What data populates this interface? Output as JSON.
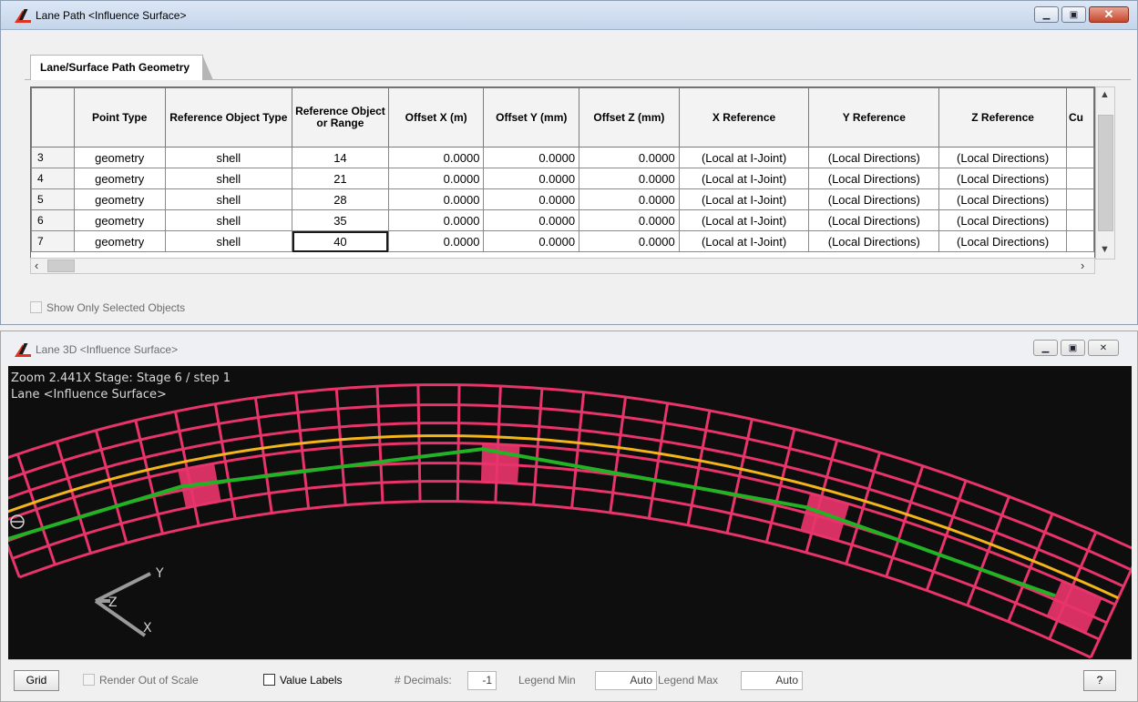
{
  "top_window": {
    "title": "Lane Path <Influence Surface>",
    "tab": "Lane/Surface Path Geometry",
    "columns": [
      {
        "label": "Point Type"
      },
      {
        "label": "Reference Object Type"
      },
      {
        "label": "Reference Object or Range"
      },
      {
        "label": "Offset X (m)"
      },
      {
        "label": "Offset Y (mm)"
      },
      {
        "label": "Offset Z (mm)"
      },
      {
        "label": "X Reference"
      },
      {
        "label": "Y Reference"
      },
      {
        "label": "Z Reference"
      },
      {
        "label": "Cu"
      }
    ],
    "rows": [
      {
        "num": "3",
        "point_type": "geometry",
        "ref_type": "shell",
        "ref_obj": "14",
        "ox": "0.0000",
        "oy": "0.0000",
        "oz": "0.0000",
        "xref": "(Local at I-Joint)",
        "yref": "(Local Directions)",
        "zref": "(Local Directions)"
      },
      {
        "num": "4",
        "point_type": "geometry",
        "ref_type": "shell",
        "ref_obj": "21",
        "ox": "0.0000",
        "oy": "0.0000",
        "oz": "0.0000",
        "xref": "(Local at I-Joint)",
        "yref": "(Local Directions)",
        "zref": "(Local Directions)"
      },
      {
        "num": "5",
        "point_type": "geometry",
        "ref_type": "shell",
        "ref_obj": "28",
        "ox": "0.0000",
        "oy": "0.0000",
        "oz": "0.0000",
        "xref": "(Local at I-Joint)",
        "yref": "(Local Directions)",
        "zref": "(Local Directions)"
      },
      {
        "num": "6",
        "point_type": "geometry",
        "ref_type": "shell",
        "ref_obj": "35",
        "ox": "0.0000",
        "oy": "0.0000",
        "oz": "0.0000",
        "xref": "(Local at I-Joint)",
        "yref": "(Local Directions)",
        "zref": "(Local Directions)"
      },
      {
        "num": "7",
        "point_type": "geometry",
        "ref_type": "shell",
        "ref_obj": "40",
        "ox": "0.0000",
        "oy": "0.0000",
        "oz": "0.0000",
        "xref": "(Local at I-Joint)",
        "yref": "(Local Directions)",
        "zref": "(Local Directions)"
      }
    ],
    "show_only_selected": "Show Only Selected Objects"
  },
  "bottom_window": {
    "title": "Lane 3D <Influence Surface>",
    "zoom_line": "Zoom  2.441X    Stage: Stage 6 / step 1",
    "lane_line": "Lane <Influence Surface>",
    "axis_y": "Y",
    "axis_z": "Z",
    "axis_x": "X",
    "toolbar": {
      "grid_button": "Grid",
      "render_out_of_scale": "Render Out of Scale",
      "value_labels": "Value Labels",
      "decimals_label": "# Decimals:",
      "decimals_value": "-1",
      "legend_min_label": "Legend Min",
      "legend_min_value": "Auto",
      "legend_max_label": "Legend Max",
      "legend_max_value": "Auto",
      "help_button": "?"
    }
  },
  "colors": {
    "mesh": "#e8346a",
    "lane_path": "#f2b51a",
    "influence_path": "#22b324",
    "canvas_bg": "#0e0e0e"
  },
  "icons": [
    "app-logo-icon",
    "minimize-icon",
    "restore-icon",
    "close-icon",
    "scroll-up-icon",
    "scroll-down-icon",
    "scroll-left-icon",
    "scroll-right-icon",
    "axis-triad-icon",
    "pan-cursor-icon"
  ]
}
